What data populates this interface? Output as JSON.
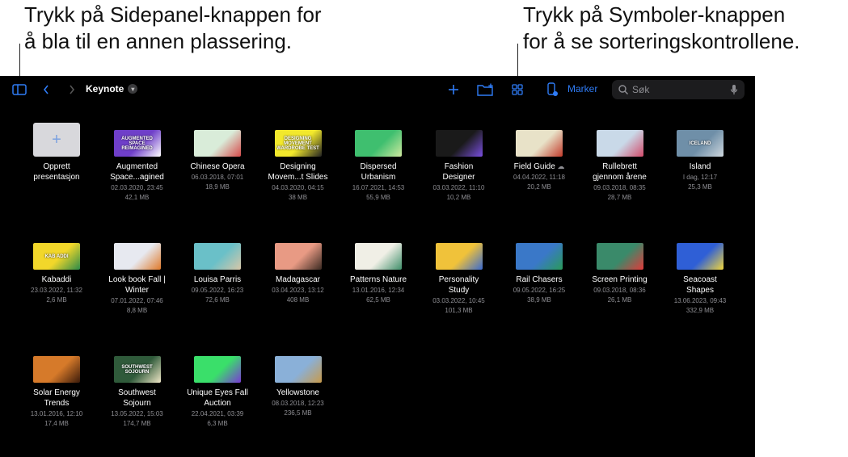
{
  "callouts": {
    "left": [
      "Trykk på Sidepanel-knappen for",
      "å bla til en annen plassering."
    ],
    "right": [
      "Trykk på Symboler-knappen",
      "for å se sorteringskontrollene."
    ]
  },
  "toolbar": {
    "title": "Keynote",
    "select_label": "Marker",
    "search_placeholder": "Søk",
    "accent": "#2f7cf6"
  },
  "files": [
    {
      "name": [
        "Opprett",
        "presentasjon"
      ],
      "date": "",
      "size": "",
      "new": true
    },
    {
      "name": [
        "Augmented",
        "Space...agined"
      ],
      "date": "02.03.2020, 23:45",
      "size": "42,1 MB",
      "colors": [
        "#6f3fc9",
        "#ffffff"
      ],
      "thumb_text": "AUGMENTED SPACE REIMAGINED"
    },
    {
      "name": [
        "Chinese Opera"
      ],
      "date": "06.03.2018, 07:01",
      "size": "18,9 MB",
      "colors": [
        "#d9ecd9",
        "#d64a4a"
      ]
    },
    {
      "name": [
        "Designing",
        "Movem...t Slides"
      ],
      "date": "04.03.2020, 04:15",
      "size": "38 MB",
      "colors": [
        "#f2e82c",
        "#222222"
      ],
      "thumb_text": "DESIGNING MOVEMENT WARDROBE TEST"
    },
    {
      "name": [
        "Dispersed",
        "Urbanism"
      ],
      "date": "16.07.2021, 14:53",
      "size": "55,9 MB",
      "colors": [
        "#3fbf6f",
        "#cfe9a0"
      ]
    },
    {
      "name": [
        "Fashion",
        "Designer"
      ],
      "date": "03.03.2022, 11:10",
      "size": "10,2 MB",
      "colors": [
        "#1a1a1a",
        "#7a4fe0"
      ]
    },
    {
      "name": [
        "Field Guide"
      ],
      "date": "04.04.2022, 11:18",
      "size": "20,2 MB",
      "colors": [
        "#e8e2c8",
        "#c23b2b"
      ],
      "cloud": true
    },
    {
      "name": [
        "Rullebrett",
        "gjennom årene"
      ],
      "date": "09.03.2018, 08:35",
      "size": "28,7 MB",
      "colors": [
        "#c9d9e8",
        "#d24a6a"
      ]
    },
    {
      "name": [
        "Island"
      ],
      "date": "I dag, 12:17",
      "size": "25,3 MB",
      "colors": [
        "#6f8fa8",
        "#cfd8de"
      ],
      "thumb_text": "ICELAND"
    },
    {
      "name": [
        "Kabaddi"
      ],
      "date": "23.03.2022, 11:32",
      "size": "2,6 MB",
      "colors": [
        "#f2d72a",
        "#2a8a4a"
      ],
      "thumb_text": "KAB ADDI"
    },
    {
      "name": [
        "Look book Fall |",
        "Winter"
      ],
      "date": "07.01.2022, 07:46",
      "size": "8,8 MB",
      "colors": [
        "#e7e9f0",
        "#e07a2a"
      ]
    },
    {
      "name": [
        "Louisa Parris"
      ],
      "date": "09.05.2022, 16:23",
      "size": "72,6 MB",
      "colors": [
        "#6ac0c8",
        "#d8c7a8"
      ]
    },
    {
      "name": [
        "Madagascar"
      ],
      "date": "03.04.2023, 13:12",
      "size": "408 MB",
      "colors": [
        "#e89a84",
        "#3a2a22"
      ]
    },
    {
      "name": [
        "Patterns Nature"
      ],
      "date": "13.01.2016, 12:34",
      "size": "62,5 MB",
      "colors": [
        "#f0efe6",
        "#3f8f6a"
      ]
    },
    {
      "name": [
        "Personality",
        "Study"
      ],
      "date": "03.03.2022, 10:45",
      "size": "101,3 MB",
      "colors": [
        "#f0c23a",
        "#3a6ad0"
      ]
    },
    {
      "name": [
        "Rail Chasers"
      ],
      "date": "09.05.2022, 16:25",
      "size": "38,9 MB",
      "colors": [
        "#3a78c8",
        "#2a9a5a"
      ]
    },
    {
      "name": [
        "Screen Printing"
      ],
      "date": "09.03.2018, 08:36",
      "size": "26,1 MB",
      "colors": [
        "#3a8a6a",
        "#e23a3a"
      ]
    },
    {
      "name": [
        "Seacoast",
        "Shapes"
      ],
      "date": "13.06.2023, 09:43",
      "size": "332,9 MB",
      "colors": [
        "#2f5fd6",
        "#f2d63a"
      ]
    },
    {
      "name": [
        "Solar Energy",
        "Trends"
      ],
      "date": "13.01.2016, 12:10",
      "size": "17,4 MB",
      "colors": [
        "#d67a2a",
        "#3a1a0a"
      ]
    },
    {
      "name": [
        "Southwest",
        "Sojourn"
      ],
      "date": "13.05.2022, 15:03",
      "size": "174,7 MB",
      "colors": [
        "#2f5a3a",
        "#f0e8c8"
      ],
      "thumb_text": "SOUTHWEST SOJOURN"
    },
    {
      "name": [
        "Unique Eyes Fall",
        "Auction"
      ],
      "date": "22.04.2021, 03:39",
      "size": "6,3 MB",
      "colors": [
        "#3adf6a",
        "#7a3ad6"
      ]
    },
    {
      "name": [
        "Yellowstone"
      ],
      "date": "08.03.2018, 12:23",
      "size": "236,5 MB",
      "colors": [
        "#8ab0d8",
        "#c89a4a"
      ]
    }
  ]
}
